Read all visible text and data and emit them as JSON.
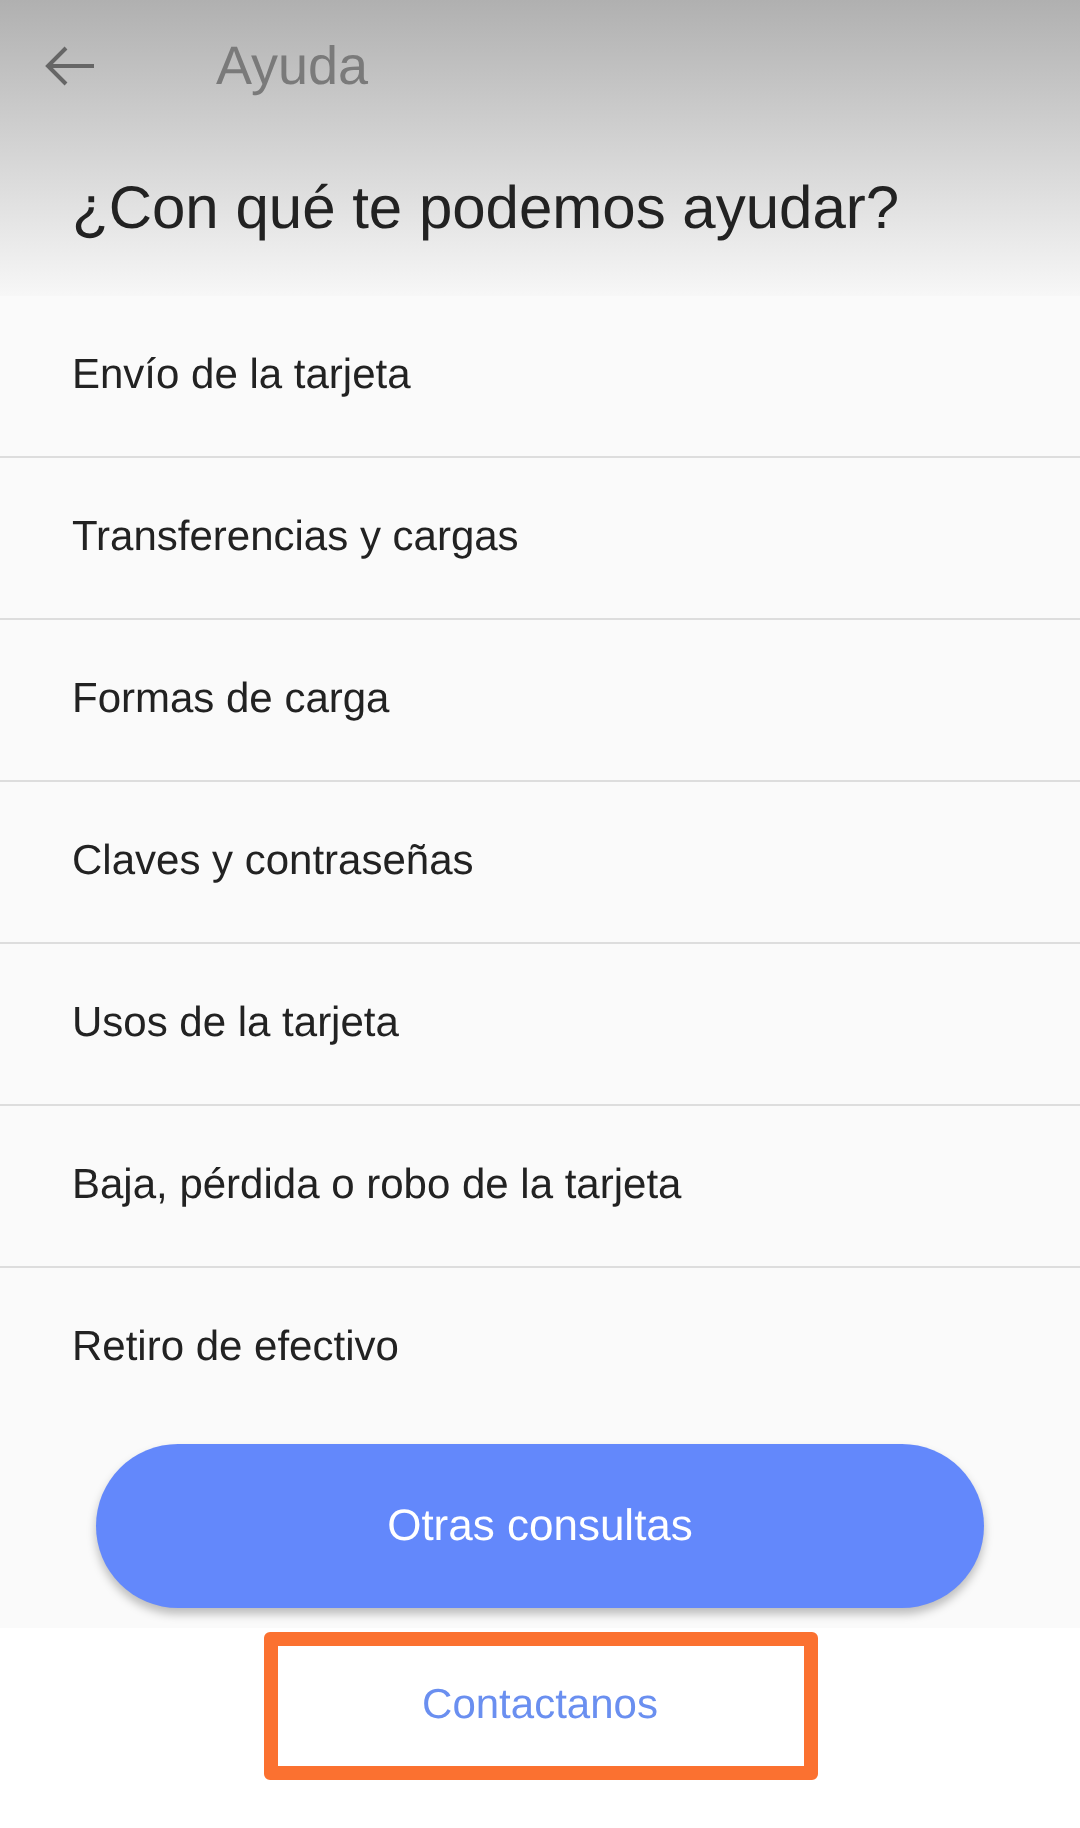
{
  "app_bar": {
    "title": "Ayuda"
  },
  "heading": "¿Con qué te podemos ayudar?",
  "topics": [
    {
      "label": "Envío de la tarjeta"
    },
    {
      "label": "Transferencias y cargas"
    },
    {
      "label": "Formas de carga"
    },
    {
      "label": "Claves y contraseñas"
    },
    {
      "label": "Usos de la tarjeta"
    },
    {
      "label": "Baja, pérdida o robo de la tarjeta"
    },
    {
      "label": "Retiro de efectivo"
    }
  ],
  "primary_button": {
    "label": "Otras consultas"
  },
  "contact_link": {
    "label": "Contactanos",
    "highlighted": true
  }
}
